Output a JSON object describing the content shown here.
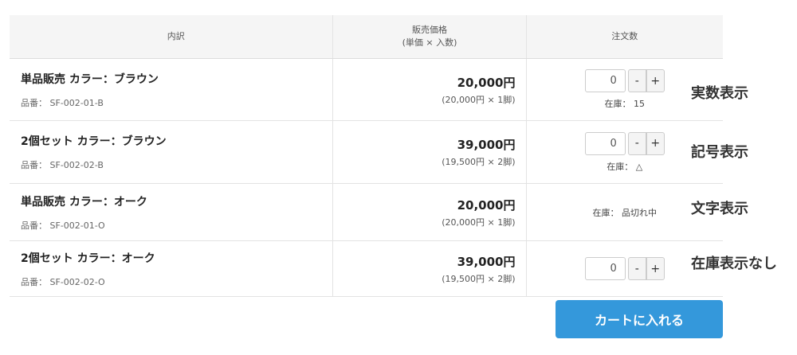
{
  "table": {
    "headers": {
      "detail": "内訳",
      "price_line1": "販売価格",
      "price_line2": "(単価 × 入数)",
      "quantity": "注文数"
    },
    "rows": [
      {
        "name": "単品販売 カラー：ブラウン",
        "sku": "品番： SF-002-01-B",
        "price": "20,000円",
        "unit_price": "(20,000円 × 1脚)",
        "qty_value": "0",
        "stock": "在庫： 15"
      },
      {
        "name": "2個セット カラー：ブラウン",
        "sku": "品番： SF-002-02-B",
        "price": "39,000円",
        "unit_price": "(19,500円 × 2脚)",
        "qty_value": "0",
        "stock": "在庫： △"
      },
      {
        "name": "単品販売 カラー：オーク",
        "sku": "品番： SF-002-01-O",
        "price": "20,000円",
        "unit_price": "(20,000円 × 1脚)",
        "stock": "在庫： 品切れ中"
      },
      {
        "name": "2個セット カラー：オーク",
        "sku": "品番： SF-002-02-O",
        "price": "39,000円",
        "unit_price": "(19,500円 × 2脚)",
        "qty_value": "0"
      }
    ]
  },
  "controls": {
    "minus": "-",
    "plus": "+"
  },
  "annotations": [
    "実数表示",
    "記号表示",
    "文字表示",
    "在庫表示なし"
  ],
  "cart_button": "カートに入れる",
  "colors": {
    "accent": "#3498db",
    "header_bg": "#f5f5f5"
  }
}
